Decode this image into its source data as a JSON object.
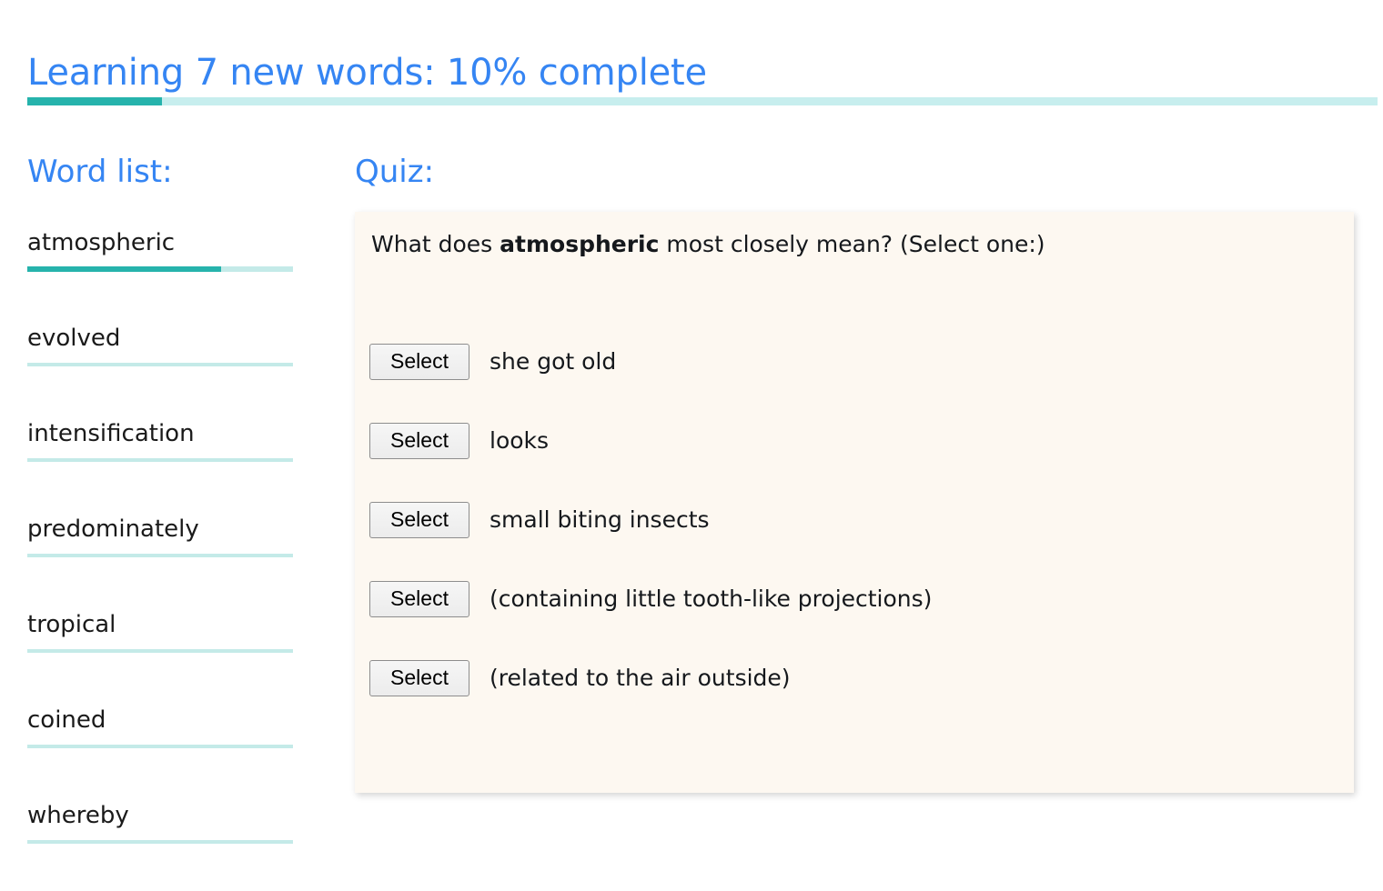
{
  "header": {
    "title": "Learning 7 new words: 10% complete",
    "progress_percent": 10,
    "progress_fill_color": "#26b3ac",
    "progress_track_color": "#c7eeee",
    "title_color": "#3585f3"
  },
  "wordlist": {
    "heading": "Word list:",
    "items": [
      {
        "label": "atmospheric",
        "progress_percent": 73,
        "active": true
      },
      {
        "label": "evolved",
        "progress_percent": 0,
        "active": false
      },
      {
        "label": "intensification",
        "progress_percent": 0,
        "active": false
      },
      {
        "label": "predominately",
        "progress_percent": 0,
        "active": false
      },
      {
        "label": "tropical",
        "progress_percent": 0,
        "active": false
      },
      {
        "label": "coined",
        "progress_percent": 0,
        "active": false
      },
      {
        "label": "whereby",
        "progress_percent": 0,
        "active": false
      }
    ]
  },
  "quiz": {
    "heading": "Quiz:",
    "panel_background": "#fdf8f1",
    "question": {
      "prefix": "What does ",
      "word": "atmospheric",
      "suffix": " most closely mean? (Select one:)"
    },
    "options": [
      {
        "button_label": "Select",
        "text": "she got old"
      },
      {
        "button_label": "Select",
        "text": "looks"
      },
      {
        "button_label": "Select",
        "text": "small biting insects"
      },
      {
        "button_label": "Select",
        "text": "(containing little tooth-like projections)"
      },
      {
        "button_label": "Select",
        "text": "(related to the air outside)"
      }
    ]
  }
}
